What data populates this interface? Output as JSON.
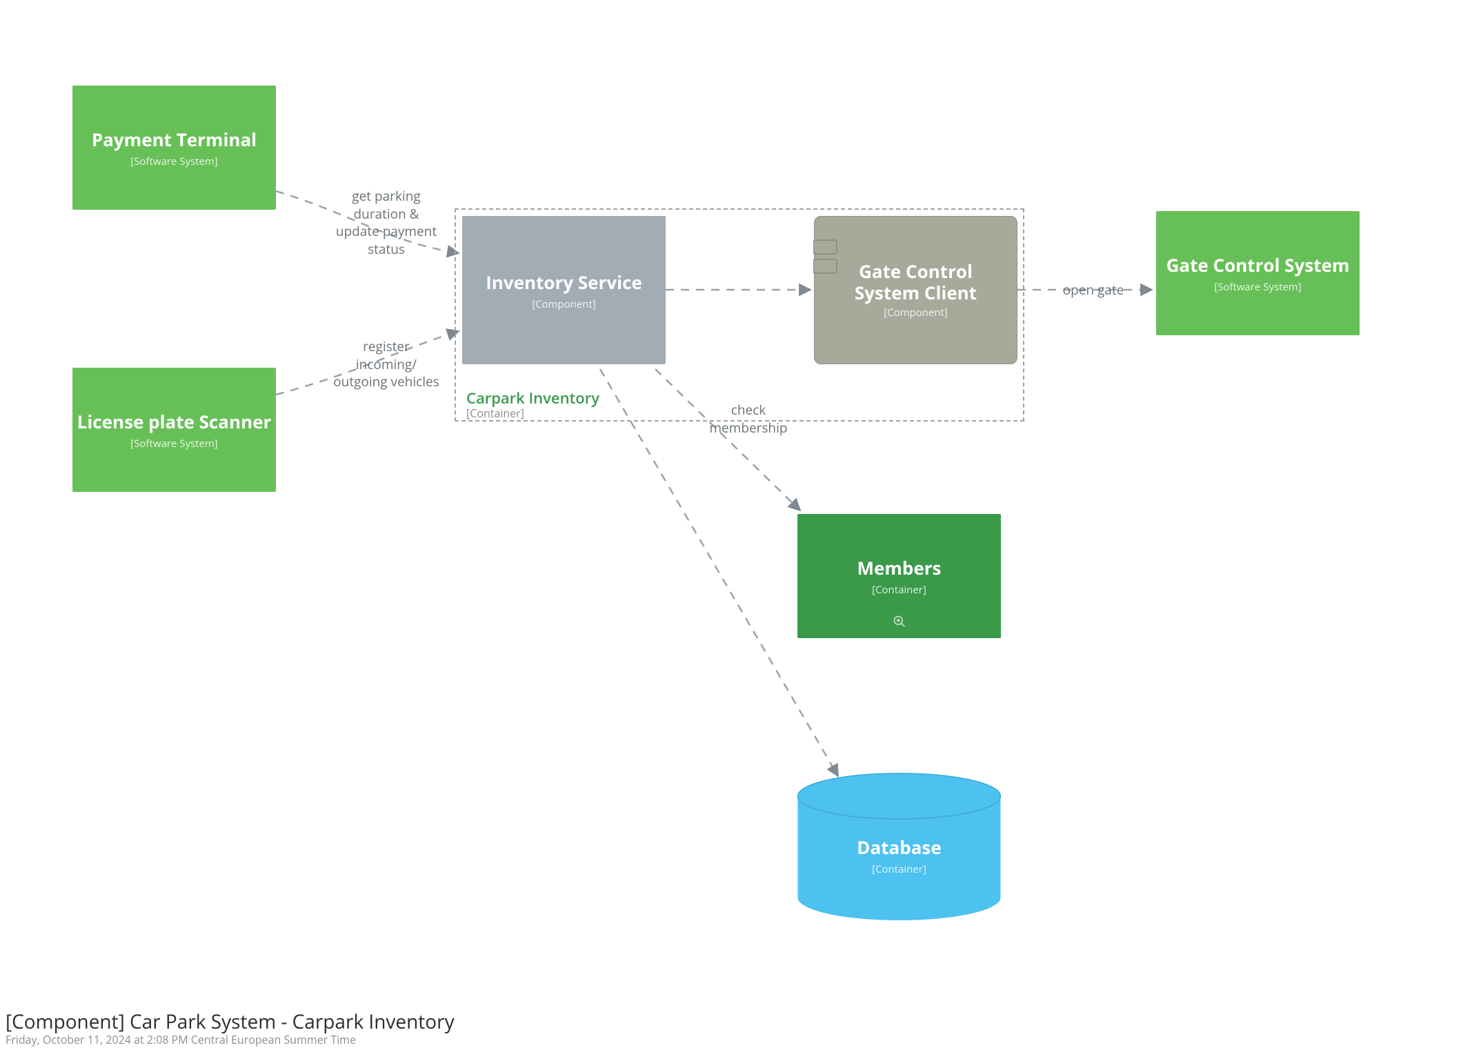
{
  "colors": {
    "green": "#67c057",
    "darkgreen": "#3a9a4a",
    "grey": "#a2acb5",
    "olive": "#a8a99a",
    "dash": "#9aa3ab",
    "blue": "#4dc1ef",
    "blueDark": "#3aa9d6",
    "text": "#6c7378"
  },
  "nodes": {
    "paymentTerminal": {
      "title": "Payment Terminal",
      "subtitle": "[Software System]"
    },
    "licensePlateScanner": {
      "title": "License plate Scanner",
      "subtitle": "[Software System]"
    },
    "inventoryService": {
      "title": "Inventory Service",
      "subtitle": "[Component]"
    },
    "gateControlClient": {
      "title": "Gate Control System Client",
      "subtitle": "[Component]"
    },
    "gateControlSystem": {
      "title": "Gate Control System",
      "subtitle": "[Software System]"
    },
    "members": {
      "title": "Members",
      "subtitle": "[Container]"
    },
    "database": {
      "title": "Database",
      "subtitle": "[Container]"
    }
  },
  "group": {
    "title": "Carpark Inventory",
    "subtitle": "[Container]"
  },
  "edges": {
    "getParking": "get parking\nduration &\nupdate payment\nstatus",
    "registerVehicles": "register\nincoming/\noutgoing vehicles",
    "checkMembership": "check\nmembership",
    "openGate": "open gate"
  },
  "footer": {
    "title": "[Component] Car Park System - Carpark Inventory",
    "subtitle": "Friday, October 11, 2024 at 2:08 PM Central European Summer Time"
  }
}
